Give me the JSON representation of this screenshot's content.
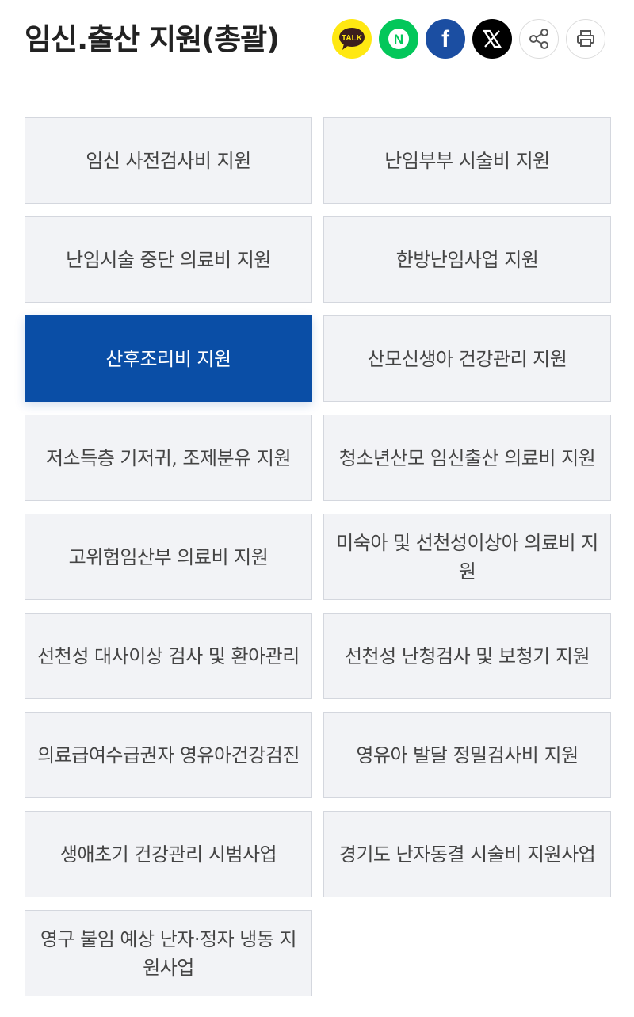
{
  "header": {
    "title": "임신.출산 지원(총괄)"
  },
  "share": {
    "kakao_label": "TALK",
    "naver_label": "N",
    "facebook_label": "f",
    "x_label": "𝕏"
  },
  "menu": {
    "items": [
      {
        "label": "임신 사전검사비 지원",
        "active": false
      },
      {
        "label": "난임부부 시술비 지원",
        "active": false
      },
      {
        "label": "난임시술 중단 의료비 지원",
        "active": false
      },
      {
        "label": "한방난임사업 지원",
        "active": false
      },
      {
        "label": "산후조리비 지원",
        "active": true
      },
      {
        "label": "산모신생아 건강관리 지원",
        "active": false
      },
      {
        "label": "저소득층 기저귀, 조제분유 지원",
        "active": false
      },
      {
        "label": "청소년산모 임신출산 의료비 지원",
        "active": false
      },
      {
        "label": "고위험임산부 의료비 지원",
        "active": false
      },
      {
        "label": "미숙아 및 선천성이상아 의료비 지원",
        "active": false
      },
      {
        "label": "선천성 대사이상 검사 및 환아관리",
        "active": false
      },
      {
        "label": "선천성 난청검사 및 보청기 지원",
        "active": false
      },
      {
        "label": "의료급여수급권자 영유아건강검진",
        "active": false
      },
      {
        "label": "영유아 발달 정밀검사비 지원",
        "active": false
      },
      {
        "label": "생애초기 건강관리 시범사업",
        "active": false
      },
      {
        "label": "경기도 난자동결 시술비 지원사업",
        "active": false
      },
      {
        "label": "영구 불임 예상 난자·정자 냉동 지원사업",
        "active": false
      }
    ]
  }
}
